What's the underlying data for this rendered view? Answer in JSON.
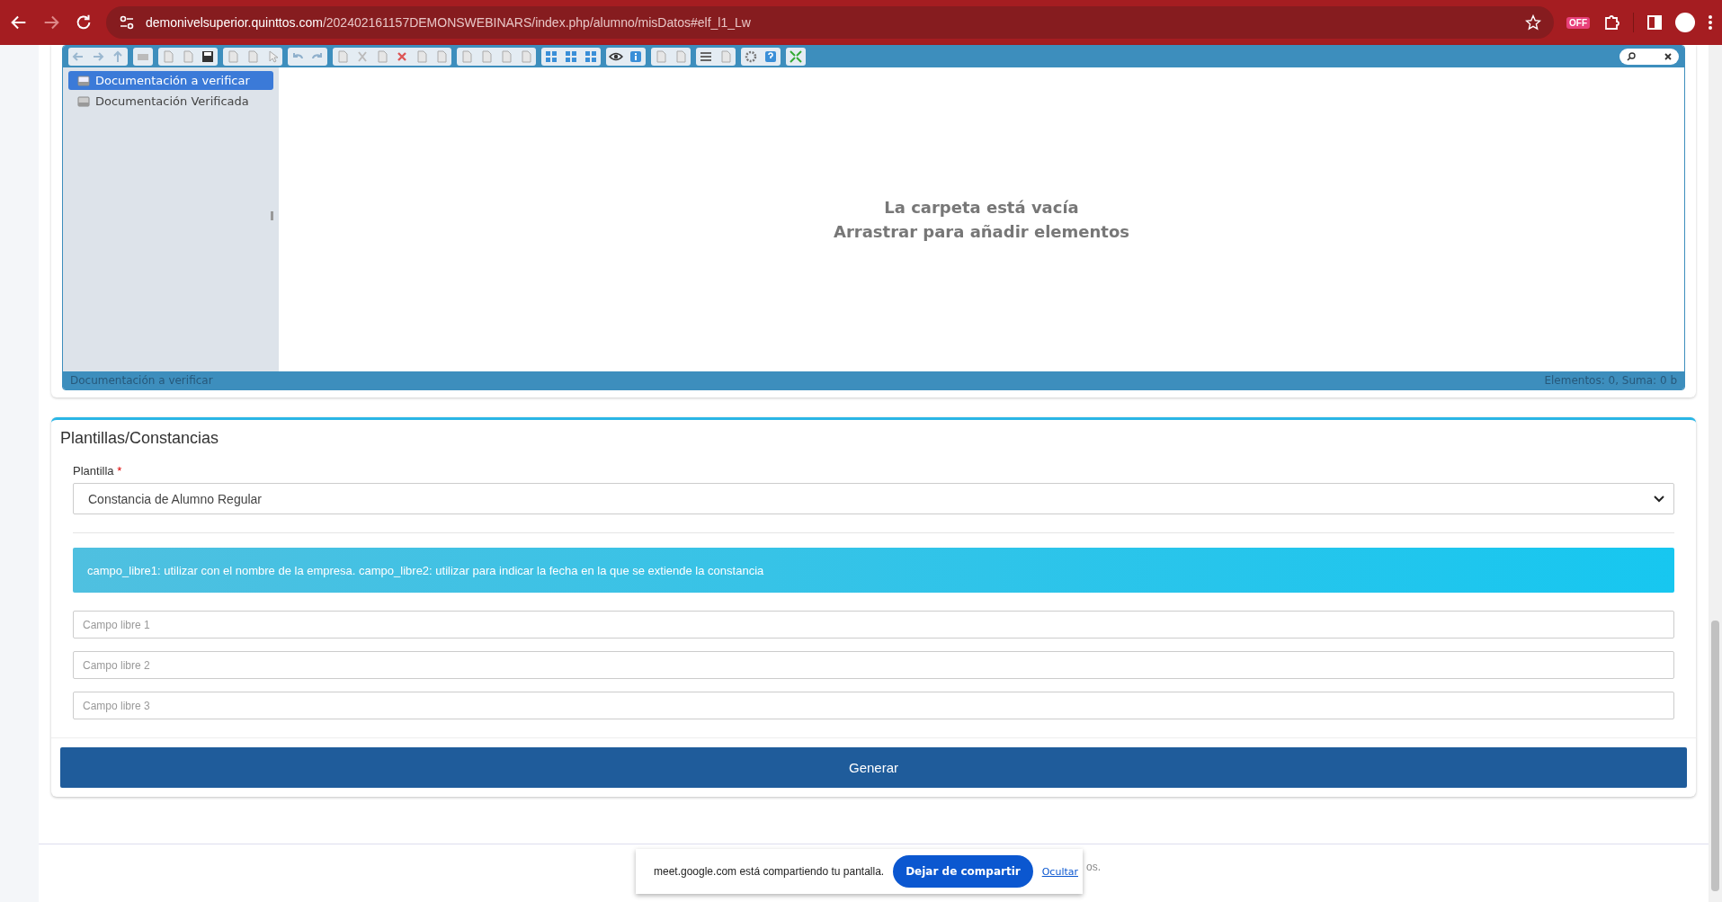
{
  "browser": {
    "url_host": "demonivelsuperior.quinttos.com",
    "url_path": "/202402161157DEMONSWEBINARS/index.php/alumno/misDatos#elf_l1_Lw",
    "extension_badge": "OFF"
  },
  "file_manager": {
    "tree": [
      {
        "label": "Documentación a verificar",
        "selected": true
      },
      {
        "label": "Documentación Verificada",
        "selected": false
      }
    ],
    "empty_title": "La carpeta está vacía",
    "empty_hint": "Arrastrar para añadir elementos",
    "status_left": "Documentación a verificar",
    "status_right": "Elementos: 0, Suma: 0 b"
  },
  "templates": {
    "title": "Plantillas/Constancias",
    "select_label": "Plantilla",
    "required_mark": "*",
    "select_value": "Constancia de Alumno Regular",
    "info": "campo_libre1: utilizar con el nombre de la empresa. campo_libre2: utilizar para indicar la fecha en la que se extiende la constancia",
    "fields": [
      {
        "placeholder": "Campo libre 1"
      },
      {
        "placeholder": "Campo libre 2"
      },
      {
        "placeholder": "Campo libre 3"
      }
    ],
    "button": "Generar"
  },
  "footer": {
    "text_tail": "os."
  },
  "share_banner": {
    "message": "meet.google.com está compartiendo tu pantalla.",
    "stop_button": "Dejar de compartir",
    "hide_link": "Ocultar"
  }
}
